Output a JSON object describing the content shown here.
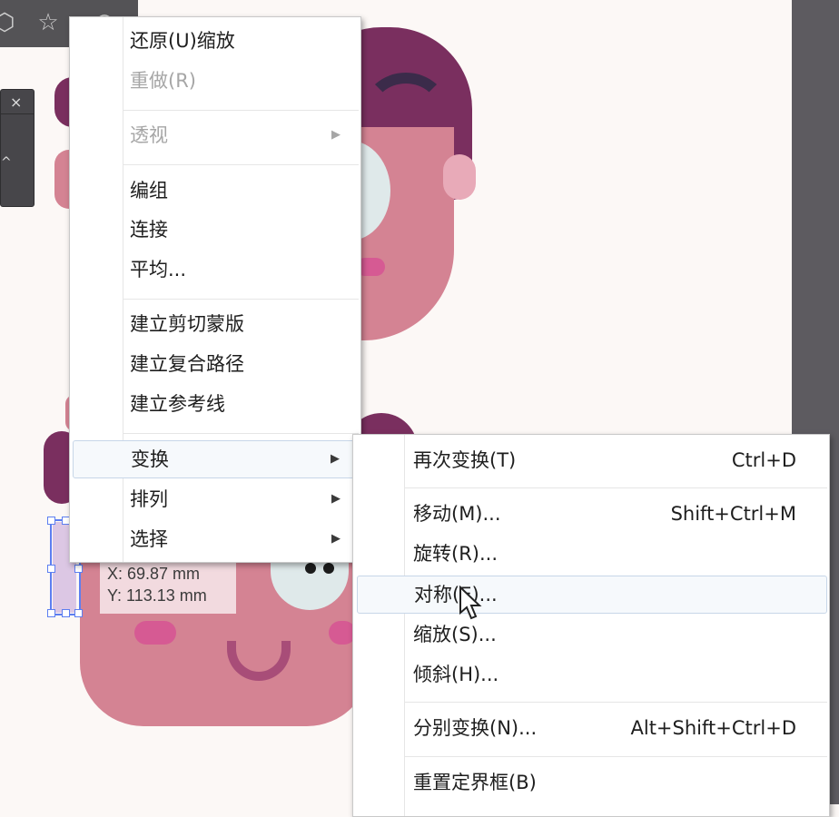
{
  "toolbar": {
    "icons": [
      "shape-icon",
      "star-icon",
      "symbol-icon"
    ]
  },
  "mini_panel": {
    "close_glyph": "×"
  },
  "context_menu": {
    "items": [
      {
        "label": "还原(U)缩放",
        "enabled": true
      },
      {
        "label": "重做(R)",
        "enabled": false
      },
      {
        "label": "透视",
        "enabled": false,
        "submenu": true
      },
      {
        "label": "编组",
        "enabled": true
      },
      {
        "label": "连接",
        "enabled": true
      },
      {
        "label": "平均...",
        "enabled": true
      },
      {
        "label": "建立剪切蒙版",
        "enabled": true
      },
      {
        "label": "建立复合路径",
        "enabled": true
      },
      {
        "label": "建立参考线",
        "enabled": true
      },
      {
        "label": "变换",
        "enabled": true,
        "submenu": true,
        "highlighted": true
      },
      {
        "label": "排列",
        "enabled": true,
        "submenu": true
      },
      {
        "label": "选择",
        "enabled": true,
        "submenu": true
      }
    ]
  },
  "transform_submenu": {
    "items": [
      {
        "label": "再次变换(T)",
        "shortcut": "Ctrl+D"
      },
      {
        "label": "移动(M)...",
        "shortcut": "Shift+Ctrl+M"
      },
      {
        "label": "旋转(R)...",
        "shortcut": ""
      },
      {
        "label": "对称(E)...",
        "shortcut": "",
        "highlighted": true
      },
      {
        "label": "缩放(S)...",
        "shortcut": ""
      },
      {
        "label": "倾斜(H)...",
        "shortcut": ""
      },
      {
        "label": "分别变换(N)...",
        "shortcut": "Alt+Shift+Ctrl+D"
      },
      {
        "label": "重置定界框(B)",
        "shortcut": ""
      }
    ]
  },
  "coord_tooltip": {
    "x": "X: 69.87 mm",
    "y": "Y: 113.13 mm"
  },
  "colors": {
    "hair": "#7a2f5f",
    "skin": "#d48393",
    "skin_light": "#e8aab8",
    "cheek": "#d65a93",
    "eye_white": "#dfe9ea",
    "accent_blue": "#5d7ef0"
  }
}
